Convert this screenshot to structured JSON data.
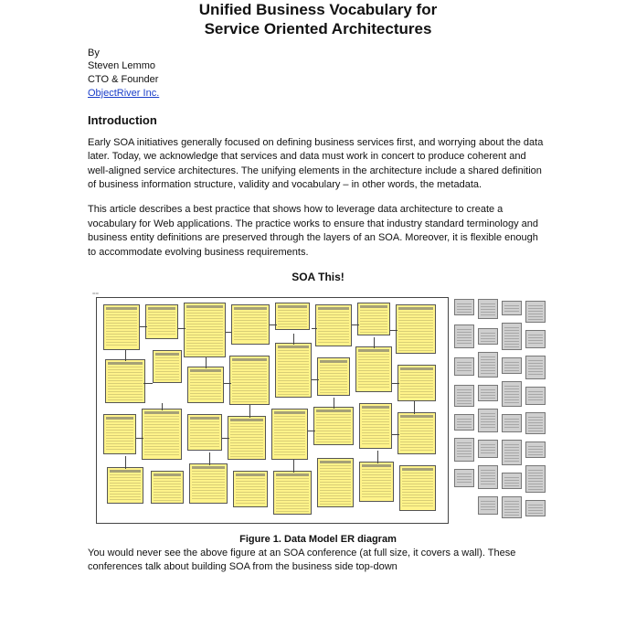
{
  "title_line1": "Unified Business Vocabulary for",
  "title_line2": "Service Oriented Architectures",
  "byline": {
    "by": "By",
    "author": "Steven Lemmo",
    "role": "CTO & Founder",
    "company": "ObjectRiver Inc."
  },
  "intro_heading": "Introduction",
  "intro_p1": "Early SOA initiatives generally focused on defining business services first, and worrying about the data later. Today, we acknowledge that services and data must work in concert to produce coherent and well-aligned service architectures. The unifying elements in the architecture include a shared definition of business information structure, validity and vocabulary – in other words, the metadata.",
  "intro_p2": "This article describes a best practice that shows how to leverage data architecture to create a vocabulary for Web applications. The practice works to ensure that industry standard terminology and business entity definitions are preserved through the layers of an SOA. Moreover, it is flexible enough to accommodate evolving business requirements.",
  "figure_subtitle": "SOA This!",
  "figure_caption": "Figure 1. Data Model ER diagram",
  "after_fig": "You would never see the above figure at an SOA conference (at full size, it covers a wall). These conferences talk about building SOA from the business side top-down"
}
